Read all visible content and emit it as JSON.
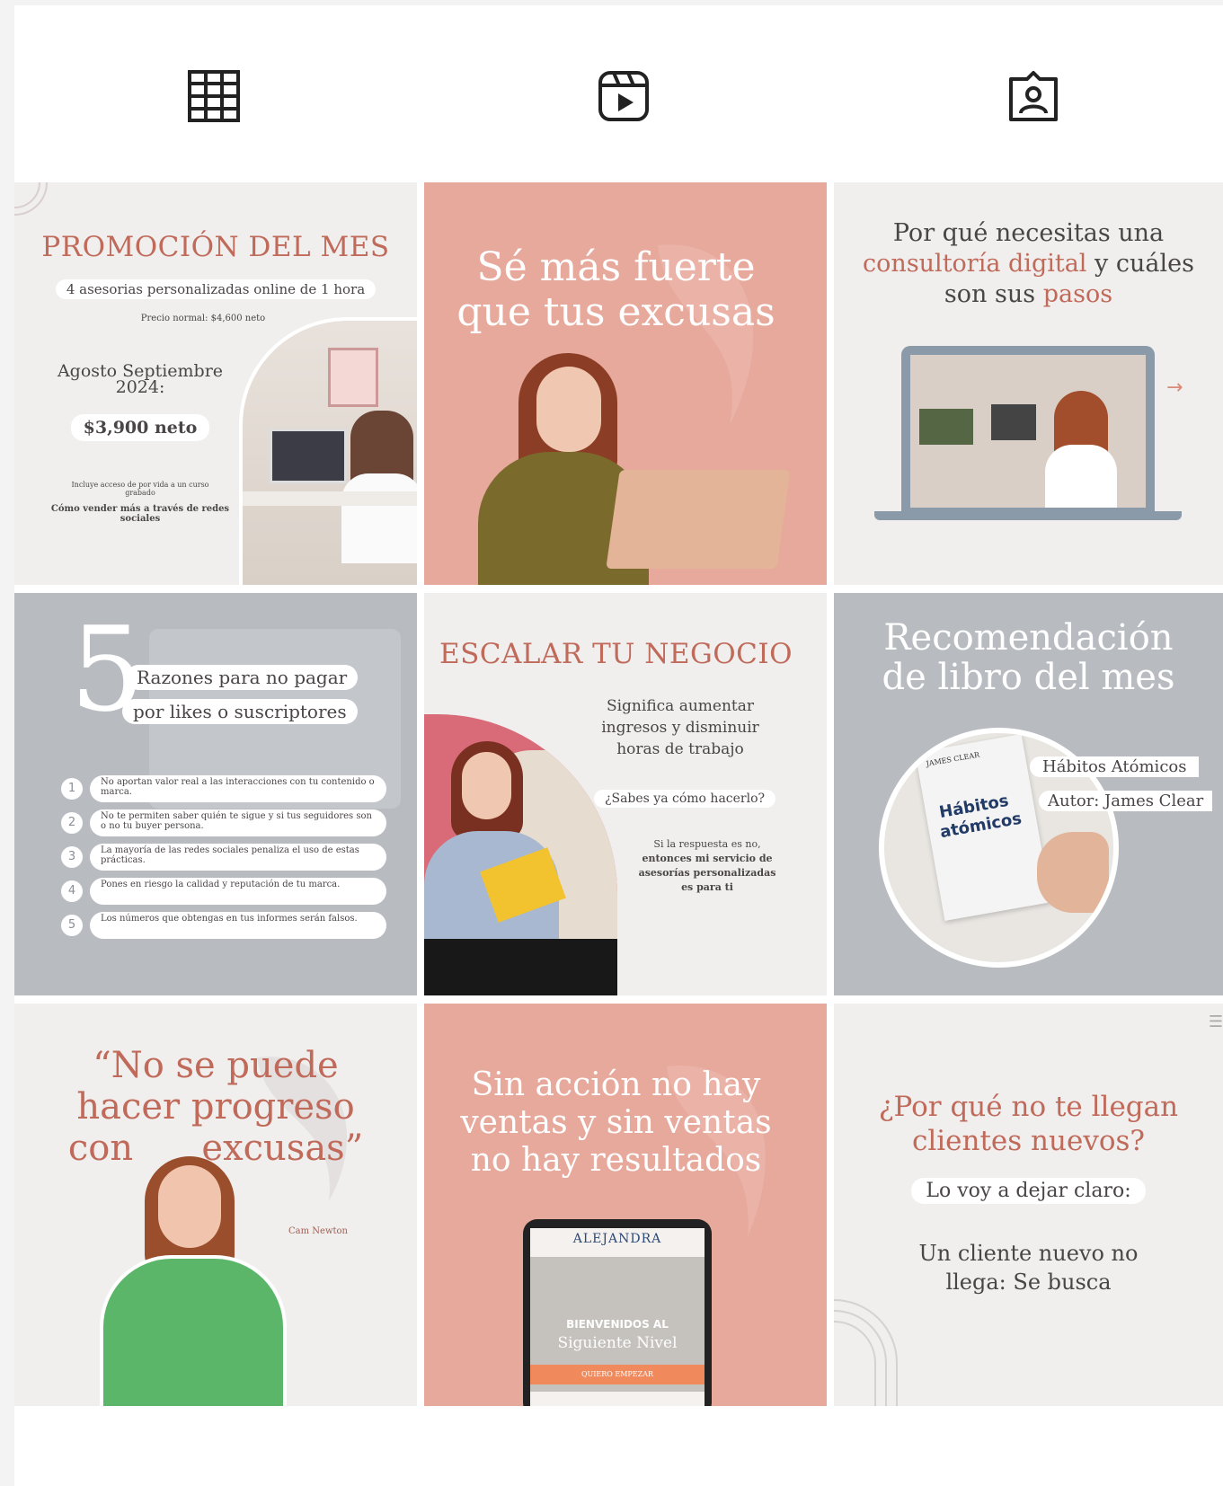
{
  "tabs": [
    {
      "name": "grid-icon"
    },
    {
      "name": "reels-icon"
    },
    {
      "name": "tagged-icon"
    }
  ],
  "colors": {
    "terra": "#c06a5a",
    "pink": "#e7a99b",
    "gray": "#b8bcc1",
    "light": "#f1eeee"
  },
  "posts": {
    "p1": {
      "title": "PROMOCIÓN DEL MES",
      "subtitle": "4 asesorias personalizadas online de 1 hora",
      "normal_price": "Precio normal: $4,600 neto",
      "months": "Agosto  Septiembre",
      "year": "2024:",
      "price": "$3,900 neto",
      "include_note": "Incluye acceso de por vida a un curso grabado",
      "course": "Cómo vender más a través de redes sociales"
    },
    "p2": {
      "line1": "Sé más fuerte",
      "line2": "que tus excusas"
    },
    "p3": {
      "line1": "Por qué necesitas una",
      "accent1": "consultoría digital",
      "mid": " y cuáles",
      "line3a": "son sus ",
      "accent2": "pasos"
    },
    "p4": {
      "number": "5",
      "heading1": "Razones para no pagar",
      "heading2": "por likes o suscriptores",
      "items": [
        {
          "n": "1",
          "text": "No aportan valor real a las interacciones con tu contenido o marca."
        },
        {
          "n": "2",
          "text": "No te permiten saber quién te sigue y si tus seguidores son o no tu buyer persona."
        },
        {
          "n": "3",
          "text": "La mayoría de las redes sociales penaliza el uso de estas prácticas."
        },
        {
          "n": "4",
          "text": "Pones en riesgo la calidad y reputación de tu marca."
        },
        {
          "n": "5",
          "text": "Los números que obtengas en tus informes serán falsos."
        }
      ]
    },
    "p5": {
      "title": "ESCALAR TU NEGOCIO",
      "body1": "Significa aumentar",
      "body2": "ingresos y disminuir",
      "body3": "horas de trabajo",
      "question": "¿Sabes ya cómo hacerlo?",
      "answer1": "Si la respuesta es no,",
      "answer2": "entonces mi servicio de",
      "answer3": "asesorías personalizadas",
      "answer4": "es para ti"
    },
    "p6": {
      "line1": "Recomendación",
      "line2": "de libro del mes",
      "book_title": "Hábitos Atómicos",
      "book_author": "Autor: James Clear",
      "cover_line1": "Hábitos",
      "cover_line2": "atómicos",
      "cover_author": "JAMES CLEAR"
    },
    "p7": {
      "line1": "“No se puede",
      "line2": "hacer progreso",
      "line3": "con      excusas”",
      "author": "Cam Newton"
    },
    "p8": {
      "line1": "Sin acción no hay",
      "line2": "ventas y sin ventas",
      "line3": "no hay resultados",
      "tablet_brand": "ALEJANDRA",
      "tablet_welcome1": "BIENVENIDOS AL",
      "tablet_welcome2": "Siguiente Nivel",
      "tablet_cta": "QUIERO EMPEZAR"
    },
    "p9": {
      "line1": "¿Por qué no te llegan",
      "line2": "clientes nuevos?",
      "pill": "Lo voy a dejar claro:",
      "body1": "Un cliente nuevo no",
      "body2": "llega: Se busca"
    }
  }
}
